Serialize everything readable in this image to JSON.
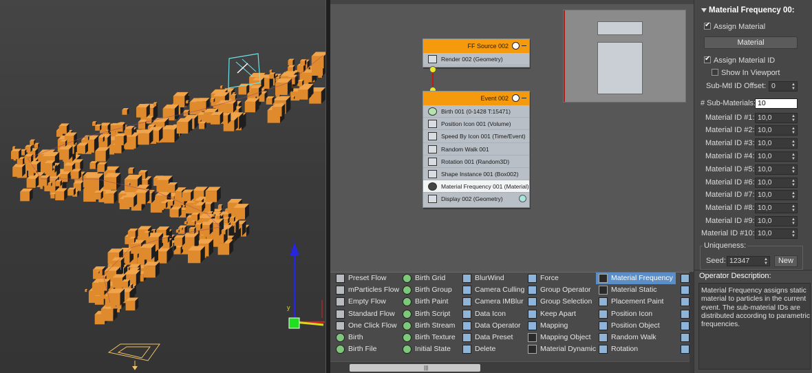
{
  "graph": {
    "source_node": {
      "title": "FF Source 002",
      "rows": [
        {
          "label": "Render 002 (Geometry)",
          "icon": "render-icon"
        }
      ]
    },
    "event_node": {
      "title": "Event 002",
      "rows": [
        {
          "label": "Birth 001 (0-1428 T:15471)",
          "icon": "birth-icon"
        },
        {
          "label": "Position Icon 001 (Volume)",
          "icon": "position-icon"
        },
        {
          "label": "Speed By Icon 001 (Time/Event)",
          "icon": "speed-icon"
        },
        {
          "label": "Random Walk 001",
          "icon": "random-walk-icon"
        },
        {
          "label": "Rotation 001 (Random3D)",
          "icon": "rotation-icon"
        },
        {
          "label": "Shape Instance 001 (Box002)",
          "icon": "shape-icon"
        },
        {
          "label": "Material Frequency 001 (Material)",
          "icon": "material-icon"
        },
        {
          "label": "Display 002 (Geometry)",
          "icon": "display-icon"
        }
      ],
      "selected_index": 6
    }
  },
  "depot": {
    "columns": [
      [
        {
          "label": "Preset Flow",
          "icon": "flow"
        },
        {
          "label": "mParticles Flow",
          "icon": "flow"
        },
        {
          "label": "Empty Flow",
          "icon": "flow"
        },
        {
          "label": "Standard Flow",
          "icon": "flow"
        },
        {
          "label": "One Click Flow",
          "icon": "flow"
        },
        {
          "label": "Birth",
          "icon": "green"
        },
        {
          "label": "Birth File",
          "icon": "green"
        }
      ],
      [
        {
          "label": "Birth Grid",
          "icon": "green"
        },
        {
          "label": "Birth Group",
          "icon": "green"
        },
        {
          "label": "Birth Paint",
          "icon": "green"
        },
        {
          "label": "Birth Script",
          "icon": "green"
        },
        {
          "label": "Birth Stream",
          "icon": "green"
        },
        {
          "label": "Birth Texture",
          "icon": "green"
        },
        {
          "label": "Initial State",
          "icon": "green"
        }
      ],
      [
        {
          "label": "BlurWind",
          "icon": "blue"
        },
        {
          "label": "Camera Culling",
          "icon": "blue"
        },
        {
          "label": "Camera IMBlur",
          "icon": "blue"
        },
        {
          "label": "Data Icon",
          "icon": "blue"
        },
        {
          "label": "Data Operator",
          "icon": "blue"
        },
        {
          "label": "Data Preset",
          "icon": "blue"
        },
        {
          "label": "Delete",
          "icon": "blue"
        }
      ],
      [
        {
          "label": "Force",
          "icon": "blue"
        },
        {
          "label": "Group Operator",
          "icon": "blue"
        },
        {
          "label": "Group Selection",
          "icon": "blue"
        },
        {
          "label": "Keep Apart",
          "icon": "blue"
        },
        {
          "label": "Mapping",
          "icon": "blue"
        },
        {
          "label": "Mapping Object",
          "icon": "dark"
        },
        {
          "label": "Material Dynamic",
          "icon": "dark"
        }
      ],
      [
        {
          "label": "Material Frequency",
          "icon": "dark"
        },
        {
          "label": "Material Static",
          "icon": "dark"
        },
        {
          "label": "Placement Paint",
          "icon": "blue"
        },
        {
          "label": "Position Icon",
          "icon": "blue"
        },
        {
          "label": "Position Object",
          "icon": "blue"
        },
        {
          "label": "Random Walk",
          "icon": "blue"
        },
        {
          "label": "Rotation",
          "icon": "blue"
        }
      ]
    ],
    "selected": "Material Frequency"
  },
  "params": {
    "rollout_title": "Material Frequency 00:",
    "assign_material_label": "Assign Material",
    "assign_material_checked": true,
    "material_button": "Material",
    "assign_material_id_label": "Assign Material ID",
    "assign_material_id_checked": true,
    "show_in_viewport_label": "Show In Viewport",
    "show_in_viewport_checked": false,
    "submtl_offset_label": "Sub-Mtl ID Offset:",
    "submtl_offset_value": "0",
    "num_submaterials_label": "# Sub-Materials:",
    "num_submaterials_value": "10",
    "material_ids": [
      {
        "label": "Material ID #1:",
        "value": "10,0"
      },
      {
        "label": "Material ID #2:",
        "value": "10,0"
      },
      {
        "label": "Material ID #3:",
        "value": "10,0"
      },
      {
        "label": "Material ID #4:",
        "value": "10,0"
      },
      {
        "label": "Material ID #5:",
        "value": "10,0"
      },
      {
        "label": "Material ID #6:",
        "value": "10,0"
      },
      {
        "label": "Material ID #7:",
        "value": "10,0"
      },
      {
        "label": "Material ID #8:",
        "value": "10,0"
      },
      {
        "label": "Material ID #9:",
        "value": "10,0"
      },
      {
        "label": "Material ID #10:",
        "value": "10,0"
      }
    ],
    "uniqueness_label": "Uniqueness:",
    "seed_label": "Seed:",
    "seed_value": "12347",
    "new_button": "New"
  },
  "description": {
    "title": "Operator Description:",
    "text": "Material Frequency assigns static material to particles in the current event. The sub-material IDs are distributed according to parametric frequencies."
  },
  "colors": {
    "particle": "#e08a2e",
    "node_header": "#f59a0c",
    "wire": "#c21818",
    "selection": "#5b8ec6"
  }
}
